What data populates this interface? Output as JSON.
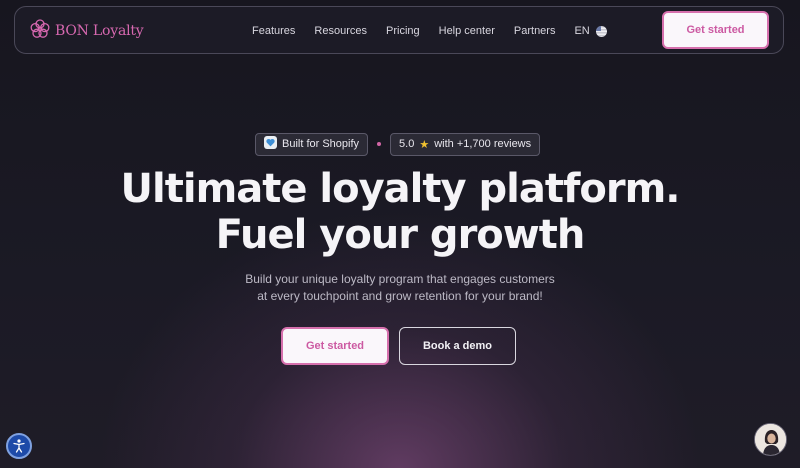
{
  "nav": {
    "logo_text": "BON Loyalty",
    "links": [
      "Features",
      "Resources",
      "Pricing",
      "Help center",
      "Partners"
    ],
    "language": "EN",
    "cta_label": "Get started"
  },
  "hero": {
    "badge_shopify": "Built for Shopify",
    "badge_rating": "5.0",
    "badge_reviews": "with +1,700 reviews",
    "headline_line1": "Ultimate loyalty platform.",
    "headline_line2": "Fuel your growth",
    "subtext_line1": "Build your unique loyalty program that engages customers",
    "subtext_line2": "at every touchpoint and grow retention for your brand!",
    "primary_cta": "Get started",
    "secondary_cta": "Book a demo"
  },
  "icons": {
    "logo": "flower-logo-icon",
    "flag": "us-flag-icon",
    "shopify": "shopify-heart-icon",
    "star": "star-icon",
    "accessibility": "accessibility-icon",
    "chat": "chat-avatar"
  },
  "colors": {
    "accent": "#d670ad",
    "background": "#16151f",
    "star": "#f2c230"
  }
}
